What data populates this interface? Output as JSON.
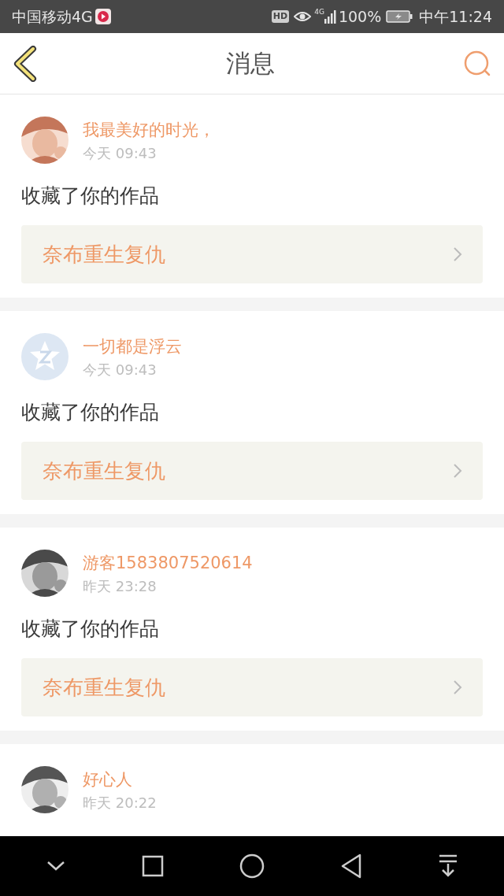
{
  "status_bar": {
    "carrier": "中国移动4G",
    "hd": "HD",
    "network": "4G",
    "battery": "100%",
    "time": "中午11:24"
  },
  "header": {
    "title": "消息"
  },
  "messages": [
    {
      "name": "我最美好的时光，",
      "time": "今天 09:43",
      "action": "收藏了你的作品",
      "work": "奈布重生复仇"
    },
    {
      "avatar": {
        "kind": "default"
      },
      "name": "一切都是浮云",
      "time": "今天 09:43",
      "action": "收藏了你的作品",
      "work": "奈布重生复仇"
    },
    {
      "name": "游客1583807520614",
      "time": "昨天 23:28",
      "action": "收藏了你的作品",
      "work": "奈布重生复仇"
    },
    {
      "name": "好心人",
      "time": "昨天 20:22"
    }
  ]
}
